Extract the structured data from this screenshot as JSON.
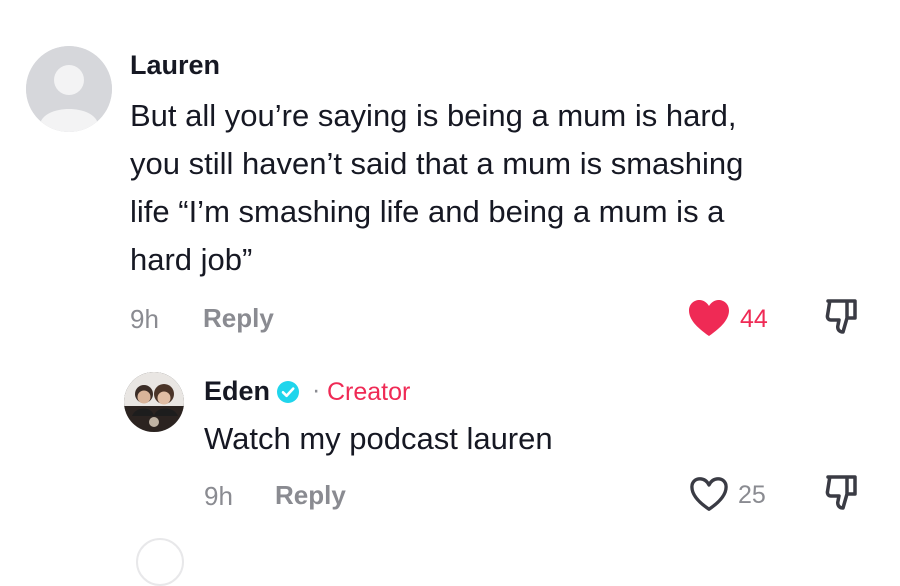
{
  "comment": {
    "username": "Lauren",
    "text_lines": [
      "But all you’re saying is being a mum is hard,",
      "you still haven’t said that a mum is smashing",
      "life “I’m smashing life and being a mum is a",
      "hard job”"
    ],
    "time": "9h",
    "reply_label": "Reply",
    "like_count": "44",
    "liked": true,
    "icons": {
      "avatar": "default-avatar-icon",
      "like": "heart-filled-icon",
      "dislike": "thumbs-down-icon"
    }
  },
  "reply": {
    "username": "Eden",
    "separator": "·",
    "badge": "Creator",
    "text": "Watch my podcast lauren",
    "time": "9h",
    "reply_label": "Reply",
    "like_count": "25",
    "liked": false,
    "icons": {
      "verified": "verified-check-icon",
      "like": "heart-outline-icon",
      "dislike": "thumbs-down-icon"
    }
  },
  "colors": {
    "accent_red": "#ef2a55",
    "verified_blue": "#20d5ec",
    "secondary_text": "#8a8b91",
    "primary_text": "#161823"
  }
}
